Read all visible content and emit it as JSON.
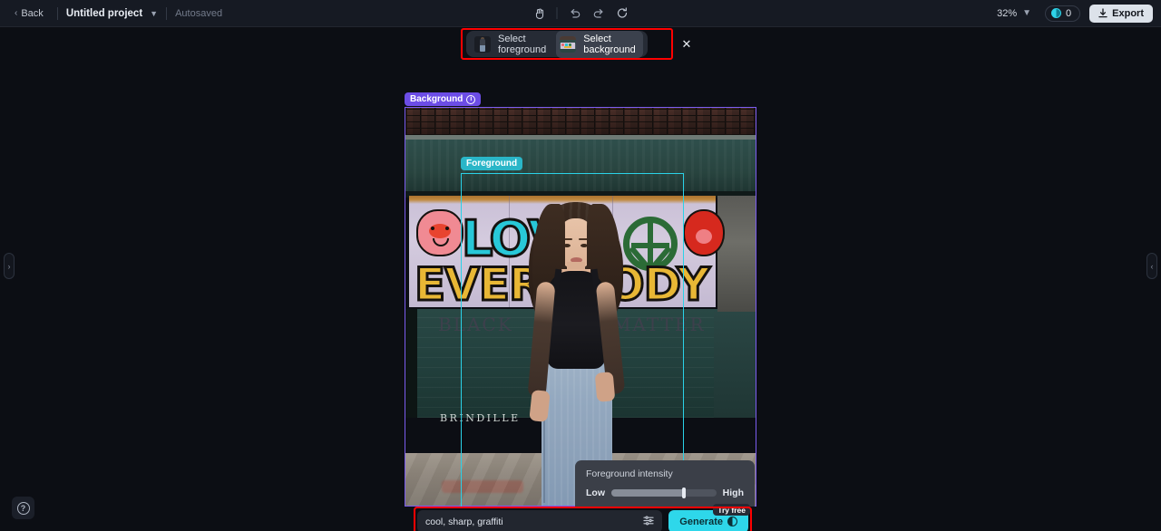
{
  "topbar": {
    "back_label": "Back",
    "project_name": "Untitled project",
    "autosaved_label": "Autosaved",
    "tools": [
      {
        "name": "hand-tool",
        "glyph": "✋"
      },
      {
        "name": "undo",
        "glyph": "↶"
      },
      {
        "name": "redo",
        "glyph": "↷"
      },
      {
        "name": "reset",
        "glyph": "⟳"
      }
    ],
    "zoom_level": "32%",
    "credits_count": "0",
    "export_label": "Export",
    "export_icon": "download-icon"
  },
  "select_toolbar": {
    "foreground_label": "Select foreground",
    "background_label": "Select background",
    "active_option": "Select background",
    "close_label": "✕"
  },
  "canvas": {
    "background_badge": "Background",
    "background_info_icon": "info-icon",
    "foreground_badge": "Foreground",
    "graffiti": {
      "love": "LOVE",
      "everybody": "EVERYBODY",
      "black": "BLACK",
      "matter": "MATTER",
      "storefront_sign": "BRINDILLE"
    }
  },
  "intensity_popover": {
    "title": "Foreground intensity",
    "low_label": "Low",
    "high_label": "High",
    "value_percent": 69
  },
  "prompt": {
    "value": "cool, sharp, graffiti",
    "settings_icon": "sliders-icon",
    "generate_label": "Generate",
    "try_free_badge": "Try free"
  },
  "panels": {
    "left_handle_icon": "›",
    "right_handle_icon": "‹",
    "help_label": "?"
  },
  "colors": {
    "accent_cyan": "#2ed7ea",
    "foreground_badge": "#2ab6c8",
    "background_badge": "#6c4de6",
    "annotation_red": "#ff0000",
    "app_bg": "#0c0e14",
    "topbar_bg": "#161a23"
  }
}
